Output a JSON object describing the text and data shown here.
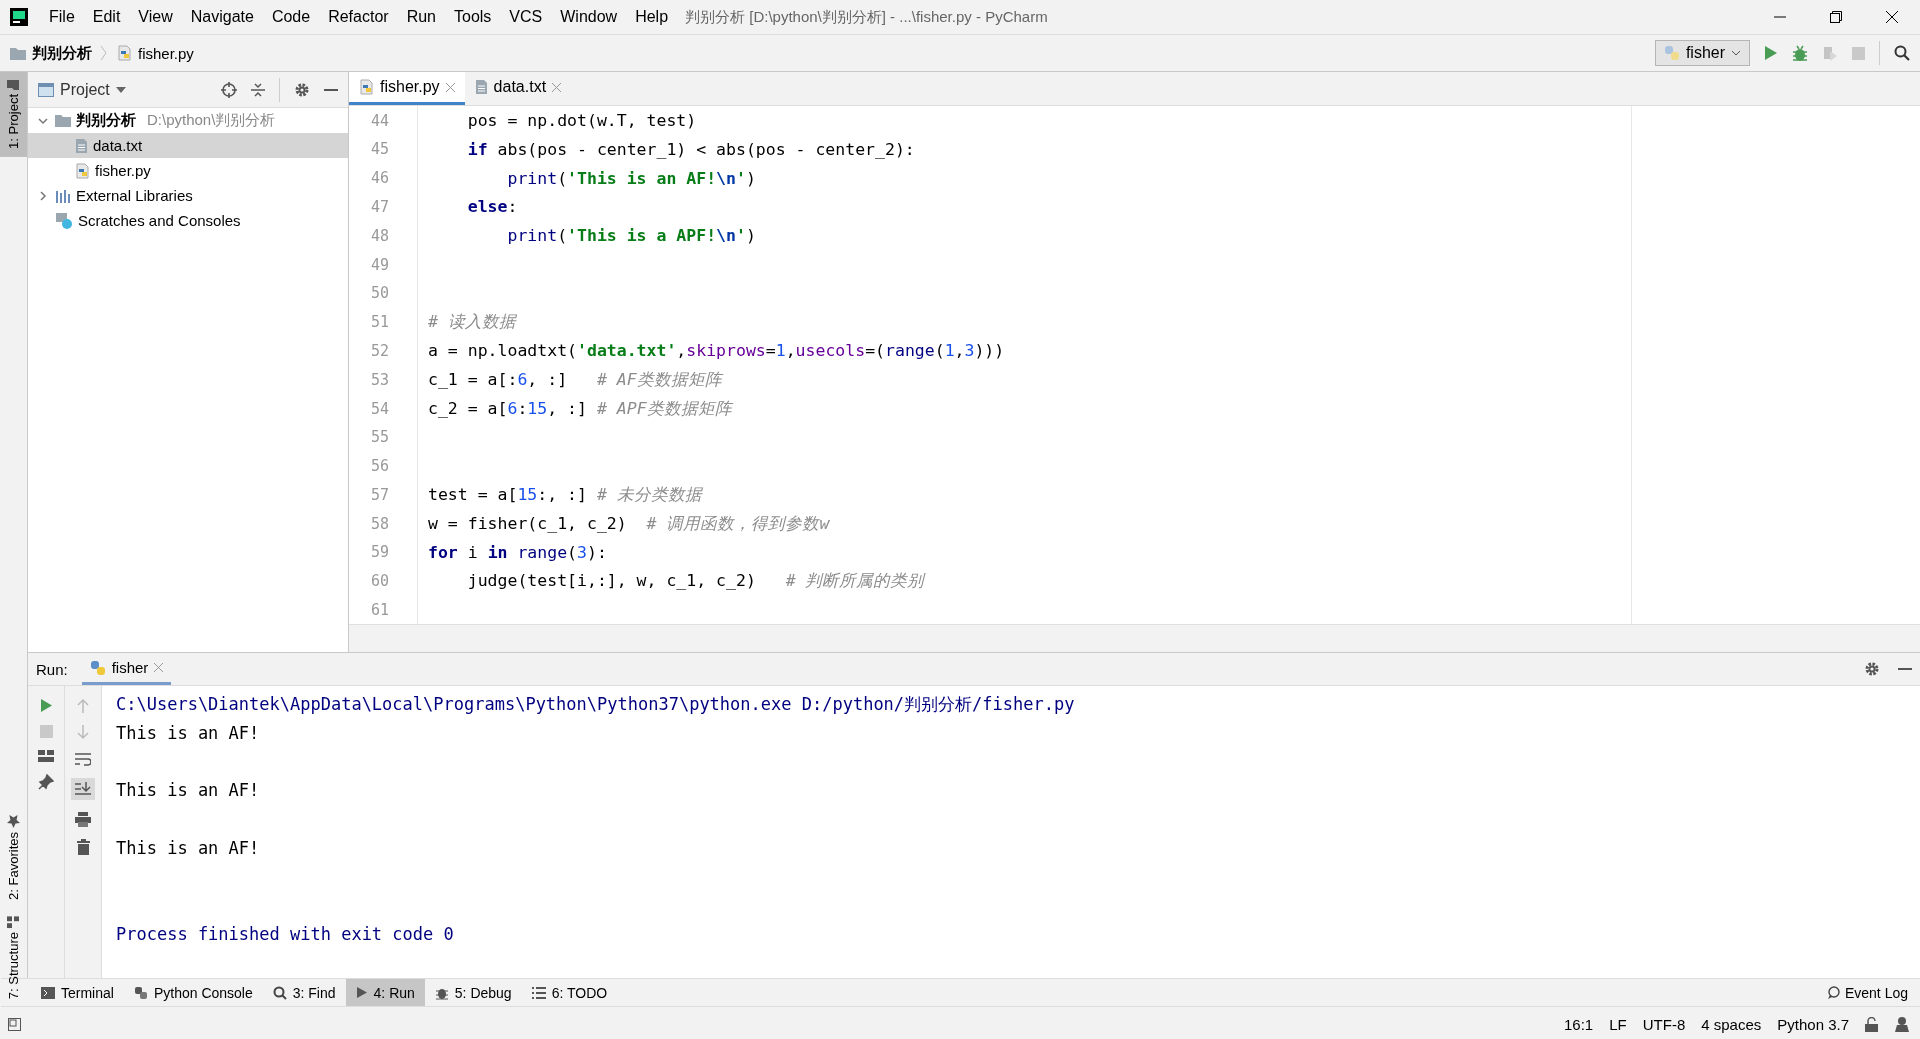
{
  "window": {
    "title": "判别分析 [D:\\python\\判别分析] - ...\\fisher.py - PyCharm",
    "menu": [
      "File",
      "Edit",
      "View",
      "Navigate",
      "Code",
      "Refactor",
      "Run",
      "Tools",
      "VCS",
      "Window",
      "Help"
    ]
  },
  "breadcrumbs": [
    {
      "label": "判别分析",
      "kind": "folder"
    },
    {
      "label": "fisher.py",
      "kind": "python"
    }
  ],
  "toolbar": {
    "run_config": "fisher"
  },
  "left_stripe": [
    {
      "label": "1: Project",
      "selected": true,
      "kind": "project"
    },
    {
      "label": "2: Favorites",
      "selected": false,
      "kind": "favorites"
    },
    {
      "label": "7: Structure",
      "selected": false,
      "kind": "structure"
    }
  ],
  "project_panel": {
    "title": "Project",
    "tree": [
      {
        "label": "判别分析",
        "path": "D:\\python\\判别分析",
        "kind": "folder",
        "expanded": true,
        "selected": false,
        "children": [
          {
            "label": "data.txt",
            "kind": "text",
            "selected": true
          },
          {
            "label": "fisher.py",
            "kind": "python",
            "selected": false
          }
        ]
      },
      {
        "label": "External Libraries",
        "kind": "library",
        "expanded": false,
        "selected": false
      },
      {
        "label": "Scratches and Consoles",
        "kind": "scratch",
        "selected": false
      }
    ]
  },
  "editor_tabs": [
    {
      "label": "fisher.py",
      "kind": "python",
      "selected": true
    },
    {
      "label": "data.txt",
      "kind": "text",
      "selected": false
    }
  ],
  "code_lines": [
    {
      "number": "44",
      "segments": [
        {
          "text": "    pos = np.dot(w.T, test)",
          "kind": "plain"
        }
      ]
    },
    {
      "number": "45",
      "segments": [
        {
          "text": "    if",
          "kind": "keyword"
        },
        {
          "text": " abs(pos - center_1) < abs(pos - center_2):",
          "kind": "plain"
        }
      ]
    },
    {
      "number": "46",
      "segments": [
        {
          "text": "        print",
          "kind": "builtin"
        },
        {
          "text": "(",
          "kind": "plain"
        },
        {
          "text": "'This is an AF!",
          "kind": "string"
        },
        {
          "text": "\\n",
          "kind": "escape"
        },
        {
          "text": "'",
          "kind": "string"
        },
        {
          "text": ")",
          "kind": "plain"
        }
      ]
    },
    {
      "number": "47",
      "segments": [
        {
          "text": "    else",
          "kind": "keyword"
        },
        {
          "text": ":",
          "kind": "plain"
        }
      ]
    },
    {
      "number": "48",
      "segments": [
        {
          "text": "        print",
          "kind": "builtin"
        },
        {
          "text": "(",
          "kind": "plain"
        },
        {
          "text": "'This is a APF!",
          "kind": "string"
        },
        {
          "text": "\\n",
          "kind": "escape"
        },
        {
          "text": "'",
          "kind": "string"
        },
        {
          "text": ")",
          "kind": "plain"
        }
      ]
    },
    {
      "number": "49"
    },
    {
      "number": "50"
    },
    {
      "number": "51",
      "segments": [
        {
          "text": "# 读入数据",
          "kind": "comment"
        }
      ]
    },
    {
      "number": "52",
      "segments": [
        {
          "text": "a = np.loadtxt(",
          "kind": "plain"
        },
        {
          "text": "'data.txt'",
          "kind": "string"
        },
        {
          "text": ",",
          "kind": "plain"
        },
        {
          "text": "skiprows",
          "kind": "param"
        },
        {
          "text": "=",
          "kind": "plain"
        },
        {
          "text": "1",
          "kind": "number"
        },
        {
          "text": ",",
          "kind": "plain"
        },
        {
          "text": "usecols",
          "kind": "param"
        },
        {
          "text": "=(",
          "kind": "plain"
        },
        {
          "text": "range",
          "kind": "builtin"
        },
        {
          "text": "(",
          "kind": "plain"
        },
        {
          "text": "1",
          "kind": "number"
        },
        {
          "text": ",",
          "kind": "plain"
        },
        {
          "text": "3",
          "kind": "number"
        },
        {
          "text": ")))",
          "kind": "plain"
        }
      ]
    },
    {
      "number": "53",
      "segments": [
        {
          "text": "c_1 = a[:",
          "kind": "plain"
        },
        {
          "text": "6",
          "kind": "number"
        },
        {
          "text": ", :]   ",
          "kind": "plain"
        },
        {
          "text": "# AF类数据矩阵",
          "kind": "comment"
        }
      ]
    },
    {
      "number": "54",
      "segments": [
        {
          "text": "c_2 = a[",
          "kind": "plain"
        },
        {
          "text": "6",
          "kind": "number"
        },
        {
          "text": ":",
          "kind": "plain"
        },
        {
          "text": "15",
          "kind": "number"
        },
        {
          "text": ", :] ",
          "kind": "plain"
        },
        {
          "text": "# APF类数据矩阵",
          "kind": "comment"
        }
      ]
    },
    {
      "number": "55"
    },
    {
      "number": "56"
    },
    {
      "number": "57",
      "segments": [
        {
          "text": "test = a[",
          "kind": "plain"
        },
        {
          "text": "15",
          "kind": "number"
        },
        {
          "text": ":, :] ",
          "kind": "plain"
        },
        {
          "text": "# 未分类数据",
          "kind": "comment"
        }
      ]
    },
    {
      "number": "58",
      "segments": [
        {
          "text": "w = fisher(c_1, c_2)  ",
          "kind": "plain"
        },
        {
          "text": "# 调用函数，得到参数w",
          "kind": "comment"
        }
      ]
    },
    {
      "number": "59",
      "segments": [
        {
          "text": "for",
          "kind": "keyword"
        },
        {
          "text": " i ",
          "kind": "plain"
        },
        {
          "text": "in",
          "kind": "keyword"
        },
        {
          "text": " range",
          "kind": "builtin"
        },
        {
          "text": "(",
          "kind": "plain"
        },
        {
          "text": "3",
          "kind": "number"
        },
        {
          "text": "):",
          "kind": "plain"
        }
      ]
    },
    {
      "number": "60",
      "segments": [
        {
          "text": "    judge(test[i,:], w, c_1, c_2)   ",
          "kind": "plain"
        },
        {
          "text": "# 判断所属的类别",
          "kind": "comment"
        }
      ]
    },
    {
      "number": "61"
    }
  ],
  "run_panel": {
    "label": "Run:",
    "tab": "fisher",
    "output": [
      {
        "text": "C:\\Users\\Diantek\\AppData\\Local\\Programs\\Python\\Python37\\python.exe D:/python/判别分析/fisher.py",
        "kind": "command"
      },
      {
        "text": "This is an AF!",
        "kind": "stdout"
      },
      {
        "text": "This is an AF!",
        "kind": "stdout"
      },
      {
        "text": "This is an AF!",
        "kind": "stdout"
      },
      {
        "text": "Process finished with exit code 0",
        "kind": "exit"
      }
    ]
  },
  "tool_windows": [
    {
      "label": "Terminal",
      "kind": "terminal",
      "selected": false
    },
    {
      "label": "Python Console",
      "kind": "python",
      "selected": false
    },
    {
      "label": "3: Find",
      "kind": "find",
      "selected": false
    },
    {
      "label": "4: Run",
      "kind": "run",
      "selected": true
    },
    {
      "label": "5: Debug",
      "kind": "debug",
      "selected": false
    },
    {
      "label": "6: TODO",
      "kind": "todo",
      "selected": false
    }
  ],
  "event_log": "Event Log",
  "status_bar": [
    "16:1",
    "LF",
    "UTF-8",
    "4 spaces",
    "Python 3.7"
  ]
}
